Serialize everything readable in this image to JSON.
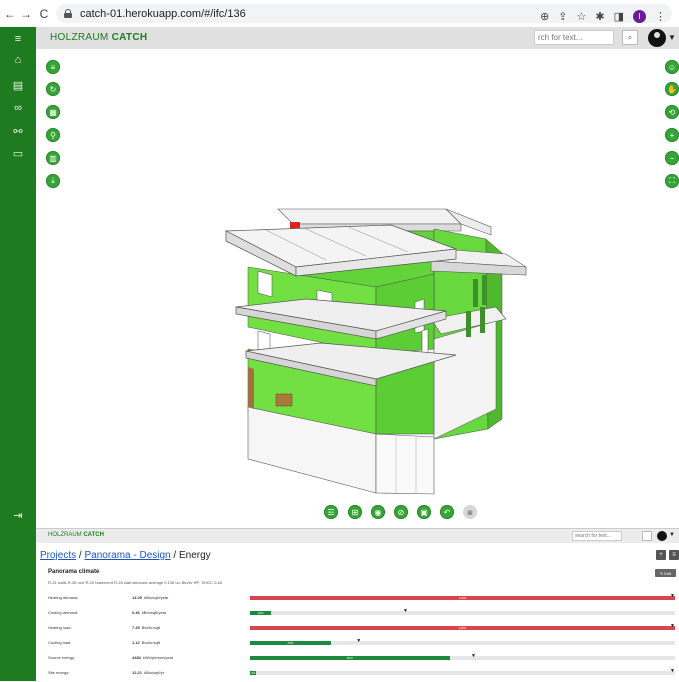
{
  "browser": {
    "url": "catch-01.herokuapp.com/#/ifc/136",
    "back": "←",
    "forward": "→",
    "reload": "C",
    "profile_initial": "I"
  },
  "app": {
    "brand_light": "HOLZRAUM",
    "brand_bold": "CATCH",
    "search_placeholder": "rch for text...",
    "colors": {
      "sidebar": "#1e7b20",
      "accent": "#36a436",
      "bar_red": "#d9454f",
      "bar_green": "#1e8a3c"
    }
  },
  "sidebar": {
    "items": [
      {
        "icon": "menu-icon",
        "glyph": "≡"
      },
      {
        "icon": "home-icon",
        "glyph": "⌂"
      },
      {
        "icon": "document-icon",
        "glyph": "▤"
      },
      {
        "icon": "connections-icon",
        "glyph": "∞"
      },
      {
        "icon": "tree-icon",
        "glyph": "⚯"
      },
      {
        "icon": "folder-icon",
        "glyph": "▭"
      }
    ],
    "logout_glyph": "⇥"
  },
  "viewer": {
    "left_tools": [
      "filter-icon",
      "refresh-icon",
      "grid-icon",
      "tree-structure-icon",
      "table-icon",
      "download-icon"
    ],
    "right_tools": [
      "person-icon",
      "hand-pan-icon",
      "orbit-icon",
      "zoom-in-icon",
      "zoom-out-icon",
      "fit-view-icon"
    ],
    "bottom_tools": [
      "section-icon",
      "section-box-icon",
      "eye-icon",
      "hide-icon",
      "isolate-icon",
      "undo-icon",
      "camera-icon"
    ]
  },
  "lower": {
    "brand_light": "HOLZRAUM",
    "brand_bold": "CATCH",
    "search_placeholder": "search for text...",
    "breadcrumb": {
      "projects": "Projects",
      "sep1": " / ",
      "panorama": "Panorama - Design",
      "sep2": " / ",
      "current": "Energy"
    },
    "card": {
      "title": "Panorama climate",
      "subtitle": "R-31 walls R-38 roof R-20 basement R-28 slab windows average 0.135 Uo Btu/hr·ft²F, SHGC 0.48",
      "edit_label": "✎ Edit"
    },
    "metrics": [
      {
        "label": "Heating demand:",
        "value": "14.09",
        "unit": "kBtu/sqft/year",
        "fill": 1.0,
        "color": "#d9454f",
        "fill_text": "112%",
        "marker": 1.0
      },
      {
        "label": "Cooling demand:",
        "value": "0.46",
        "unit": "kBtu/sqft/year",
        "fill": 0.05,
        "color": "#1e8a3c",
        "fill_text": "10%",
        "marker": 0.36
      },
      {
        "label": "Heating load:",
        "value": "7.45",
        "unit": "Btu/hr/sqft",
        "fill": 1.0,
        "color": "#d9454f",
        "fill_text": "123%",
        "marker": 1.0
      },
      {
        "label": "Cooling load:",
        "value": "1.12",
        "unit": "Btu/hr/sqft",
        "fill": 0.19,
        "color": "#1e8a3c",
        "fill_text": "75%",
        "marker": 0.25
      },
      {
        "label": "Source energy:",
        "value": "4484",
        "unit": "kWh/person/year",
        "fill": 0.47,
        "color": "#1e8a3c",
        "fill_text": "81%",
        "marker": 0.52
      },
      {
        "label": "Site energy:",
        "value": "12.21",
        "unit": "kBtu/sqft/yr",
        "fill": 0.015,
        "color": "#1e8a3c",
        "fill_text": "4%",
        "marker": 1.0
      }
    ]
  }
}
